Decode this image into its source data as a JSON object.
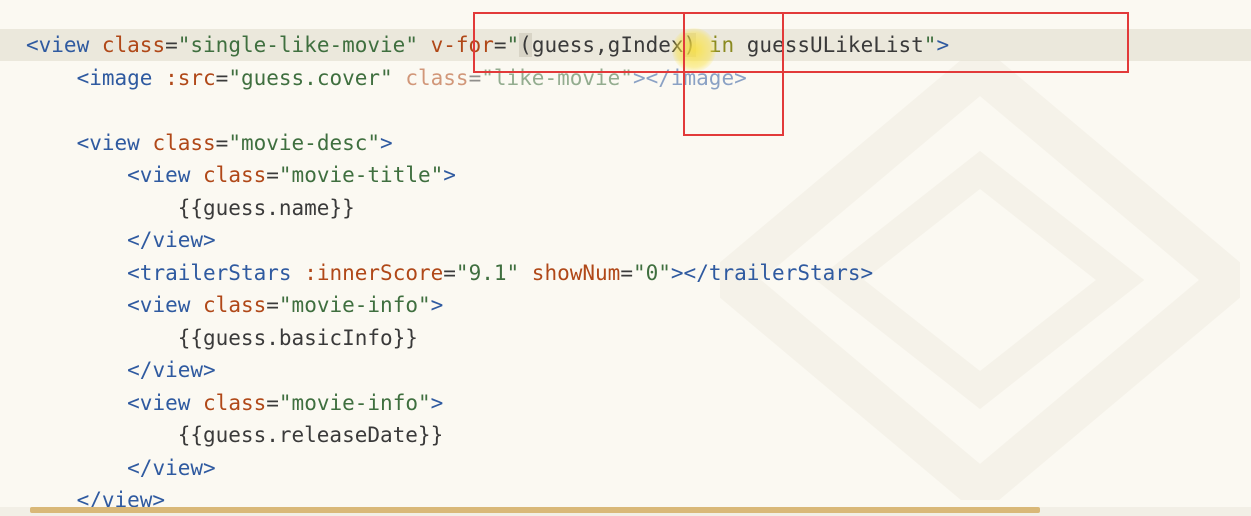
{
  "editor": {
    "lines": [
      {
        "tokens": [
          {
            "cls": "tag",
            "text": "<view"
          },
          {
            "cls": "plain",
            "text": " "
          },
          {
            "cls": "attr",
            "text": "class"
          },
          {
            "cls": "eq",
            "text": "="
          },
          {
            "cls": "str",
            "text": "\"single-like-movie\""
          },
          {
            "cls": "plain",
            "text": " "
          },
          {
            "cls": "attr",
            "text": "v-for"
          },
          {
            "cls": "eq",
            "text": "="
          },
          {
            "cls": "str",
            "text": "\""
          },
          {
            "cls": "plain sel-bracket",
            "text": "("
          },
          {
            "cls": "plain",
            "text": "guess,gIndex"
          },
          {
            "cls": "plain sel-bracket",
            "text": ")"
          },
          {
            "cls": "plain",
            "text": " "
          },
          {
            "cls": "kw",
            "text": "in"
          },
          {
            "cls": "plain",
            "text": " guessULikeList"
          },
          {
            "cls": "str",
            "text": "\""
          },
          {
            "cls": "tag",
            "text": ">"
          }
        ]
      },
      {
        "tokens": [
          {
            "cls": "plain",
            "text": "    "
          },
          {
            "cls": "tag",
            "text": "<image"
          },
          {
            "cls": "plain",
            "text": " "
          },
          {
            "cls": "attr",
            "text": ":src"
          },
          {
            "cls": "eq",
            "text": "="
          },
          {
            "cls": "str",
            "text": "\"guess.cover\""
          },
          {
            "cls": "plain",
            "text": " "
          },
          {
            "cls": "attr blur",
            "text": "class"
          },
          {
            "cls": "eq blur",
            "text": "="
          },
          {
            "cls": "str blur",
            "text": "\"like-movie\""
          },
          {
            "cls": "tag blur",
            "text": "></image>"
          }
        ]
      },
      {
        "tokens": []
      },
      {
        "tokens": [
          {
            "cls": "plain",
            "text": "    "
          },
          {
            "cls": "tag",
            "text": "<view"
          },
          {
            "cls": "plain",
            "text": " "
          },
          {
            "cls": "attr",
            "text": "class"
          },
          {
            "cls": "eq",
            "text": "="
          },
          {
            "cls": "str",
            "text": "\"movie-desc\""
          },
          {
            "cls": "tag",
            "text": ">"
          }
        ]
      },
      {
        "tokens": [
          {
            "cls": "plain",
            "text": "        "
          },
          {
            "cls": "tag",
            "text": "<view"
          },
          {
            "cls": "plain",
            "text": " "
          },
          {
            "cls": "attr",
            "text": "class"
          },
          {
            "cls": "eq",
            "text": "="
          },
          {
            "cls": "str",
            "text": "\"movie-title\""
          },
          {
            "cls": "tag",
            "text": ">"
          }
        ]
      },
      {
        "tokens": [
          {
            "cls": "plain",
            "text": "            {{guess.name}}"
          }
        ]
      },
      {
        "tokens": [
          {
            "cls": "plain",
            "text": "        "
          },
          {
            "cls": "tag",
            "text": "</view>"
          }
        ]
      },
      {
        "tokens": [
          {
            "cls": "plain",
            "text": "        "
          },
          {
            "cls": "tag",
            "text": "<trailerStars"
          },
          {
            "cls": "plain",
            "text": " "
          },
          {
            "cls": "attr",
            "text": ":innerScore"
          },
          {
            "cls": "eq",
            "text": "="
          },
          {
            "cls": "str",
            "text": "\"9.1\""
          },
          {
            "cls": "plain",
            "text": " "
          },
          {
            "cls": "attr",
            "text": "showNum"
          },
          {
            "cls": "eq",
            "text": "="
          },
          {
            "cls": "str",
            "text": "\"0\""
          },
          {
            "cls": "tag",
            "text": "></trailerStars>"
          }
        ]
      },
      {
        "tokens": [
          {
            "cls": "plain",
            "text": "        "
          },
          {
            "cls": "tag",
            "text": "<view"
          },
          {
            "cls": "plain",
            "text": " "
          },
          {
            "cls": "attr",
            "text": "class"
          },
          {
            "cls": "eq",
            "text": "="
          },
          {
            "cls": "str",
            "text": "\"movie-info\""
          },
          {
            "cls": "tag",
            "text": ">"
          }
        ]
      },
      {
        "tokens": [
          {
            "cls": "plain",
            "text": "            {{guess.basicInfo}}"
          }
        ]
      },
      {
        "tokens": [
          {
            "cls": "plain",
            "text": "        "
          },
          {
            "cls": "tag",
            "text": "</view>"
          }
        ]
      },
      {
        "tokens": [
          {
            "cls": "plain",
            "text": "        "
          },
          {
            "cls": "tag",
            "text": "<view"
          },
          {
            "cls": "plain",
            "text": " "
          },
          {
            "cls": "attr",
            "text": "class"
          },
          {
            "cls": "eq",
            "text": "="
          },
          {
            "cls": "str",
            "text": "\"movie-info\""
          },
          {
            "cls": "tag",
            "text": ">"
          }
        ]
      },
      {
        "tokens": [
          {
            "cls": "plain",
            "text": "            {{guess.releaseDate}}"
          }
        ]
      },
      {
        "tokens": [
          {
            "cls": "plain",
            "text": "        "
          },
          {
            "cls": "tag",
            "text": "</view>"
          }
        ]
      },
      {
        "tokens": [
          {
            "cls": "plain",
            "text": "    "
          },
          {
            "cls": "tag",
            "text": "</view>"
          }
        ]
      }
    ]
  },
  "colors": {
    "background": "#fbf9f2",
    "tag": "#2f5aa0",
    "attribute": "#b04818",
    "string": "#3f6f3f",
    "keyword": "#8a8a20",
    "annotation_box": "#e23a3a",
    "cursor_highlight": "#fae13c"
  }
}
